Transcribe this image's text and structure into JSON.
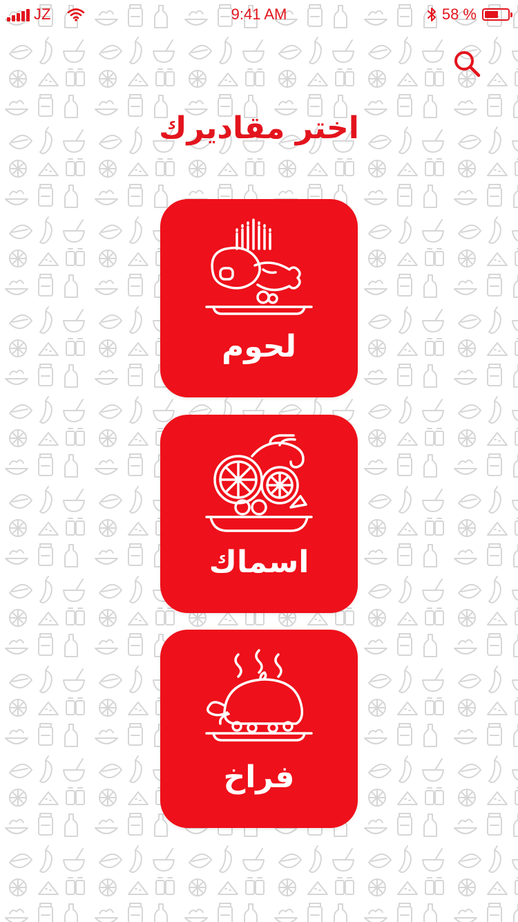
{
  "status": {
    "carrier": "JZ",
    "time": "9:41 AM",
    "battery_text": "58 %",
    "battery_level": 0.58
  },
  "header": {
    "title": "اختر مقاديرك",
    "search_icon": "search-icon"
  },
  "categories": [
    {
      "label": "لحوم",
      "icon": "meat-icon"
    },
    {
      "label": "اسماك",
      "icon": "fish-icon"
    },
    {
      "label": "فراخ",
      "icon": "roast-chicken-icon"
    }
  ],
  "colors": {
    "accent": "#e3141d",
    "card": "#ee101a",
    "pattern": "#d9d9d9",
    "background": "#ffffff"
  }
}
